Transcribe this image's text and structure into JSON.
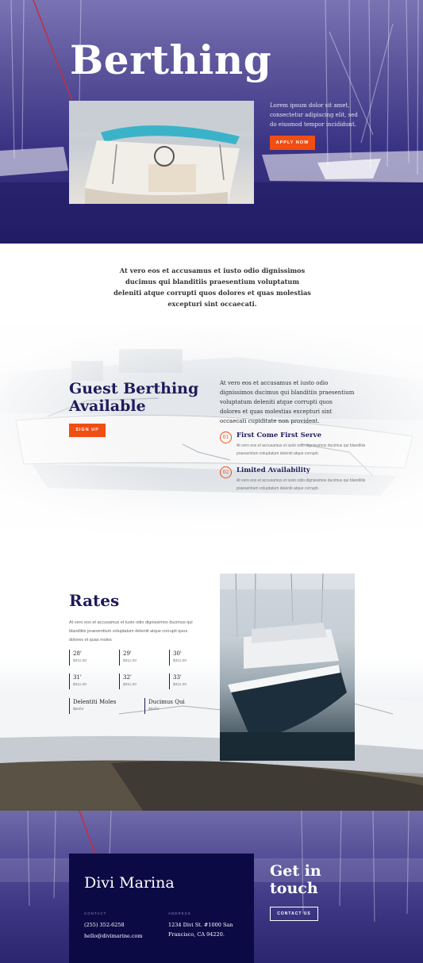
{
  "hero": {
    "title": "Berthing",
    "text": "Lorem ipsum dolor sit amet, consectetur adipiscing elit, sed do eiusmod tempor incididunt.",
    "button_label": "APPLY NOW"
  },
  "intro": {
    "text": "At vero eos et accusamus et iusto odio dignissimos ducimus qui blanditiis praesentium voluptatum deleniti atque corrupti quos dolores et quas molestias excepturi sint occaecati."
  },
  "guest": {
    "title": "Guest Berthing Available",
    "button_label": "SIGN UP",
    "text": "At vero eos et accusamus et iusto odio dignissimos ducimus qui blanditiis praesentium voluptatum deleniti atque corrupti quos dolores et quas molestias excepturi sint occaecati cupiditate non provident.",
    "features": [
      {
        "num": "01",
        "title": "First Come First Serve",
        "text": "At vero eos et accusamus et iusto odio dignissimos ducimus qui blanditiis praesentium voluptatum deleniti atque corrupti."
      },
      {
        "num": "02",
        "title": "Limited Availability",
        "text": "At vero eos et accusamus et iusto odio dignissimos ducimus qui blanditiis praesentium voluptatum deleniti atque corrupti."
      }
    ]
  },
  "rates": {
    "title": "Rates",
    "text": "At vero eos et accusamus et iusto odio dignissimos ducimus qui blanditiis praesentium voluptatum deleniti atque corrupti quos dolores et quas moles",
    "items": [
      {
        "size": "28'",
        "price": "$311.00"
      },
      {
        "size": "29'",
        "price": "$311.00"
      },
      {
        "size": "30'",
        "price": "$311.00"
      },
      {
        "size": "31'",
        "price": "$311.00"
      },
      {
        "size": "32'",
        "price": "$311.00"
      },
      {
        "size": "33'",
        "price": "$311.00"
      },
      {
        "size": "Delentiti Moles",
        "price": "$50/hr"
      },
      {
        "size": "Ducimus Qui",
        "price": "$50/hr"
      }
    ]
  },
  "footer": {
    "brand": "Divi Marina",
    "contact_label": "CONTACT",
    "phone": "(255) 352-6258",
    "email": "hello@divimarine.com",
    "address_label": "ADDRESS",
    "address_line1": "1234 Divi St. #1000 San",
    "address_line2": "Francisco, CA 94220.",
    "getin_title": "Get in touch",
    "contact_button": "CONTACT US"
  },
  "colors": {
    "navy": "#1f1a5b",
    "orange": "#f04e13",
    "footer_box": "#0c0a45"
  }
}
